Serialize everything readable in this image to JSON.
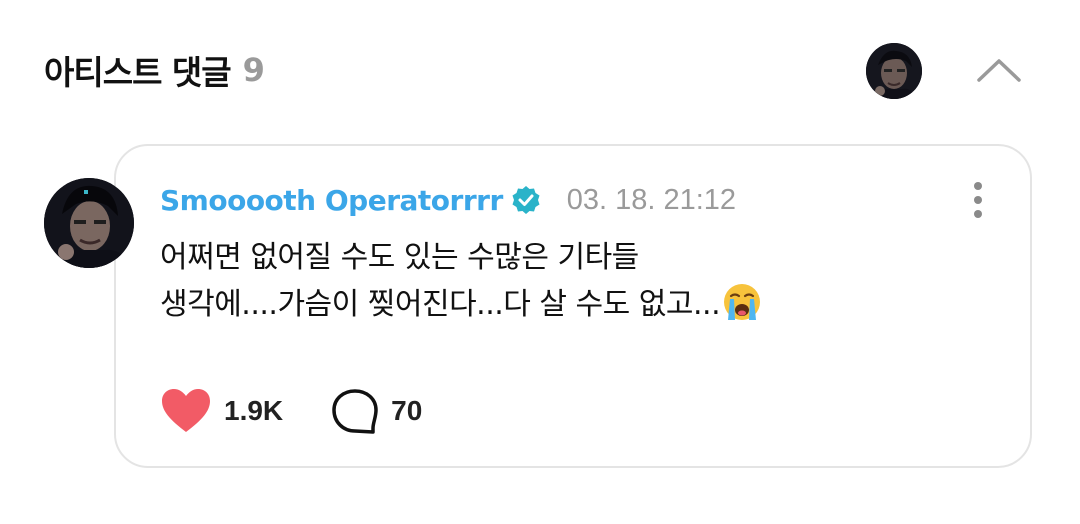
{
  "header": {
    "title": "아티스트 댓글",
    "count": "9",
    "avatar_icon": "artist-avatar",
    "collapse_icon": "chevron-up-icon"
  },
  "comment": {
    "author": "Smooooth Operatorrrr",
    "verified_icon": "verified-badge-icon",
    "timestamp": "03. 18. 21:12",
    "text_line1": "어쩌면 없어질 수도 있는 수많은 기타들",
    "text_line2": "생각에....가슴이 찢어진다...다 살 수도 없고...",
    "emoji": "loudly-crying-face",
    "likes": "1.9K",
    "replies": "70",
    "like_icon": "heart-icon",
    "reply_icon": "speech-bubble-icon",
    "more_icon": "more-vertical-icon"
  },
  "colors": {
    "accent": "#3ba6e8",
    "badge": "#2ab3c9",
    "heart": "#f25b66",
    "muted": "#9a9a9a",
    "border": "#e4e4e4"
  }
}
